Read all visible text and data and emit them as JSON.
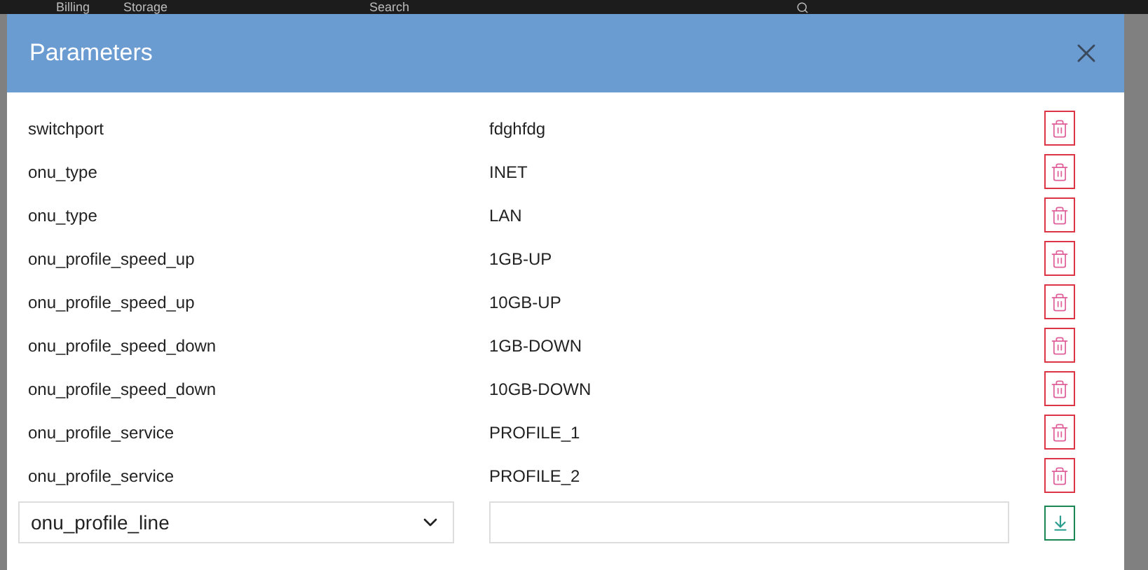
{
  "top_bar": {
    "items": [
      {
        "label": "Billing"
      },
      {
        "label": "Storage"
      }
    ],
    "search": {
      "placeholder": "Search"
    }
  },
  "dialog": {
    "title": "Parameters",
    "rows": [
      {
        "name": "switchport",
        "value": "fdghfdg"
      },
      {
        "name": "onu_type",
        "value": "INET"
      },
      {
        "name": "onu_type",
        "value": "LAN"
      },
      {
        "name": "onu_profile_speed_up",
        "value": "1GB-UP"
      },
      {
        "name": "onu_profile_speed_up",
        "value": "10GB-UP"
      },
      {
        "name": "onu_profile_speed_down",
        "value": "1GB-DOWN"
      },
      {
        "name": "onu_profile_speed_down",
        "value": "10GB-DOWN"
      },
      {
        "name": "onu_profile_service",
        "value": "PROFILE_1"
      },
      {
        "name": "onu_profile_service",
        "value": "PROFILE_2"
      }
    ],
    "new_row": {
      "select_value": "onu_profile_line"
    }
  }
}
